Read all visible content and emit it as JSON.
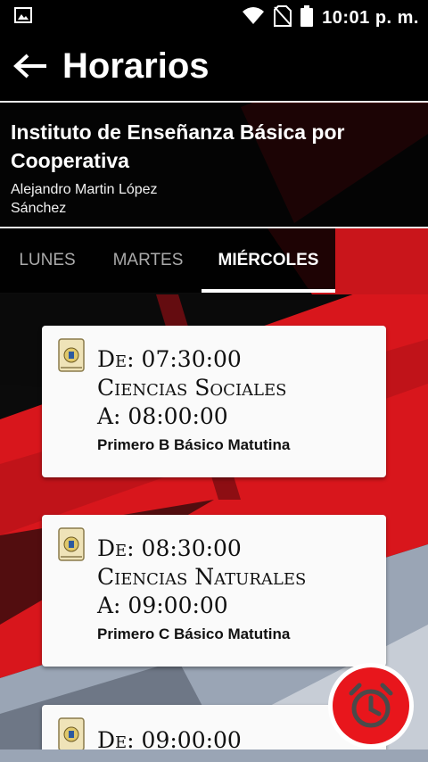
{
  "status_bar": {
    "time": "10:01 p. m.",
    "icons": [
      "image-notification-icon",
      "wifi-icon",
      "no-sim-icon",
      "battery-icon"
    ]
  },
  "toolbar": {
    "title": "Horarios",
    "back_icon": "arrow-left-icon"
  },
  "header": {
    "school": "Instituto de Enseñanza Básica por Cooperativa",
    "person": "Alejandro Martin López Sánchez"
  },
  "tabs": [
    {
      "label": "LUNES",
      "active": false
    },
    {
      "label": "MARTES",
      "active": false
    },
    {
      "label": "MIÉRCOLES",
      "active": true
    }
  ],
  "schedule": [
    {
      "from": "De: 07:30:00",
      "subject": "Ciencias Sociales",
      "to": "A: 08:00:00",
      "section": "Primero B Básico Matutina"
    },
    {
      "from": "De: 08:30:00",
      "subject": "Ciencias Naturales",
      "to": "A: 09:00:00",
      "section": "Primero C Básico Matutina"
    },
    {
      "from": "De: 09:00:00",
      "subject": "",
      "to": "",
      "section": ""
    }
  ],
  "fab": {
    "icon": "alarm-clock-icon"
  },
  "colors": {
    "accent": "#e8161c",
    "background": "#0b0b0b",
    "card": "#fafafa"
  }
}
